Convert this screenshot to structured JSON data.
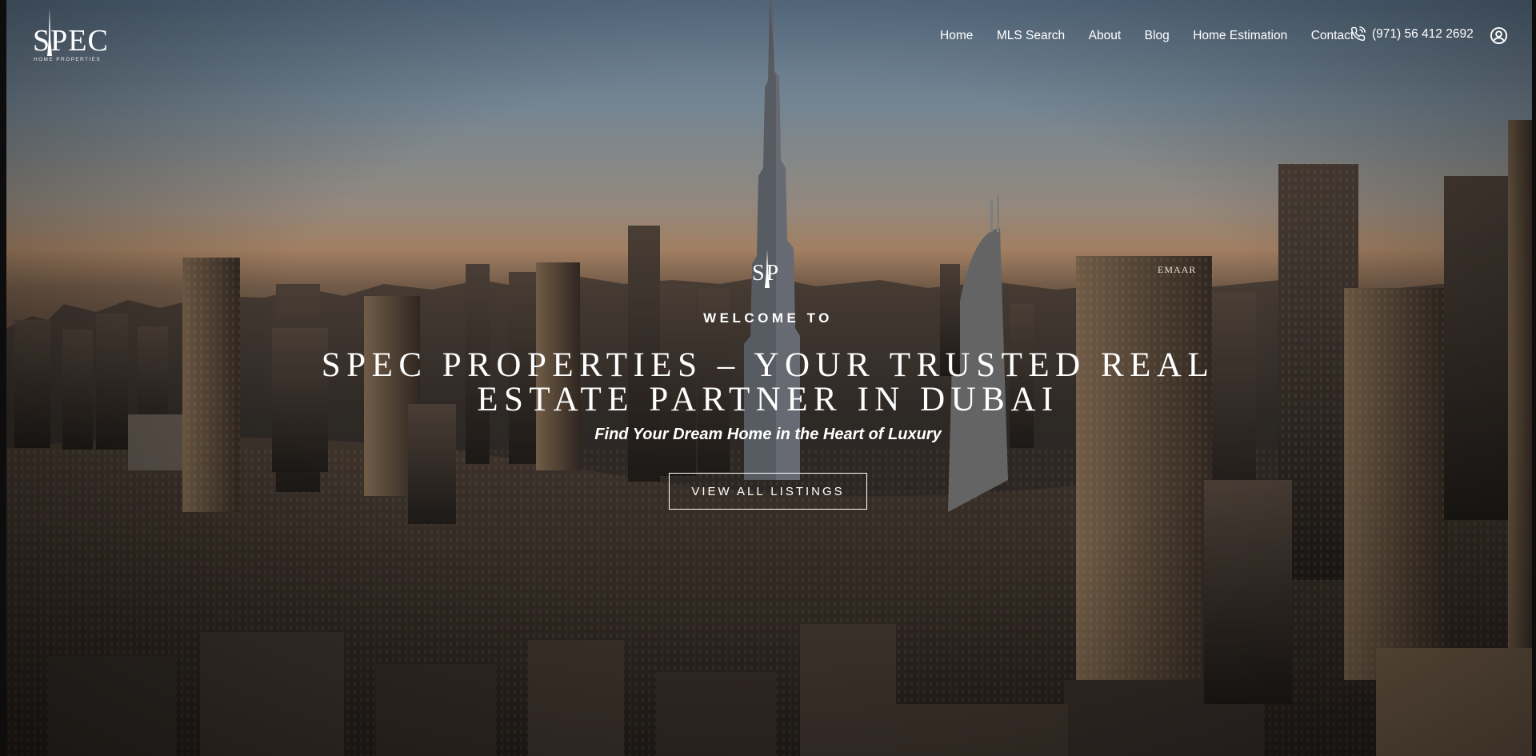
{
  "brand": {
    "logo_text": "SPEC",
    "logo_subtext": "HOME PROPERTIES",
    "monogram": "SP"
  },
  "nav": {
    "items": [
      {
        "label": "Home"
      },
      {
        "label": "MLS Search"
      },
      {
        "label": "About"
      },
      {
        "label": "Blog"
      },
      {
        "label": "Home Estimation"
      },
      {
        "label": "Contact"
      }
    ],
    "phone": "(971) 56 412 2692",
    "icons": {
      "phone": "phone-call-icon",
      "account": "user-circle-icon"
    }
  },
  "hero": {
    "welcome": "WELCOME TO",
    "headline_line1": "SPEC PROPERTIES – YOUR TRUSTED REAL",
    "headline_line2": "ESTATE PARTNER IN DUBAI",
    "tagline": "Find Your Dream Home in the Heart of Luxury",
    "cta_label": "VIEW ALL LISTINGS",
    "building_sign": "EMAAR"
  },
  "colors": {
    "text": "#ffffff",
    "sky_top": "#6f8aa6",
    "horizon": "#c69c78"
  }
}
